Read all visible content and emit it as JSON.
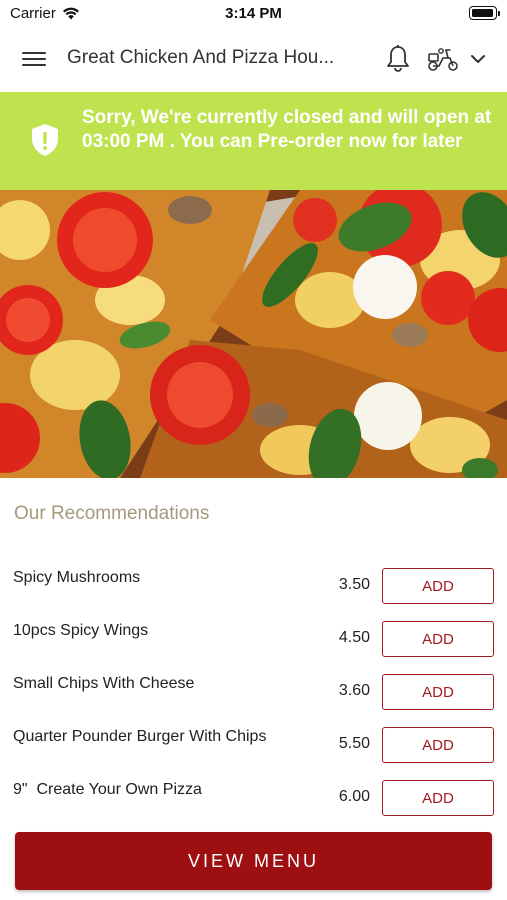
{
  "status_bar": {
    "carrier": "Carrier",
    "time": "3:14 PM"
  },
  "nav": {
    "title": "Great Chicken And Pizza Hou...",
    "icons": [
      "menu-icon",
      "bell-icon",
      "scooter-icon",
      "chevron-down-icon"
    ]
  },
  "banner": {
    "message": "Sorry, We're currently closed and will open at 03:00 PM . You can Pre-order now for later",
    "color": "#bfe34e",
    "icon": "shield-alert-icon"
  },
  "hero": {
    "icon": "pizza-photo"
  },
  "recommendations": {
    "title": "Our Recommendations",
    "items": [
      {
        "name": "Spicy Mushrooms",
        "price": "3.50",
        "action": "ADD"
      },
      {
        "name": "10pcs Spicy Wings",
        "price": "4.50",
        "action": "ADD"
      },
      {
        "name": "Small Chips With Cheese",
        "price": "3.60",
        "action": "ADD"
      },
      {
        "name": "Quarter Pounder Burger With Chips",
        "price": "5.50",
        "action": "ADD"
      },
      {
        "name": "9\"  Create Your Own Pizza",
        "price": "6.00",
        "action": "ADD"
      }
    ]
  },
  "footer": {
    "view_menu_label": "VIEW MENU",
    "color": "#9e0f12"
  }
}
